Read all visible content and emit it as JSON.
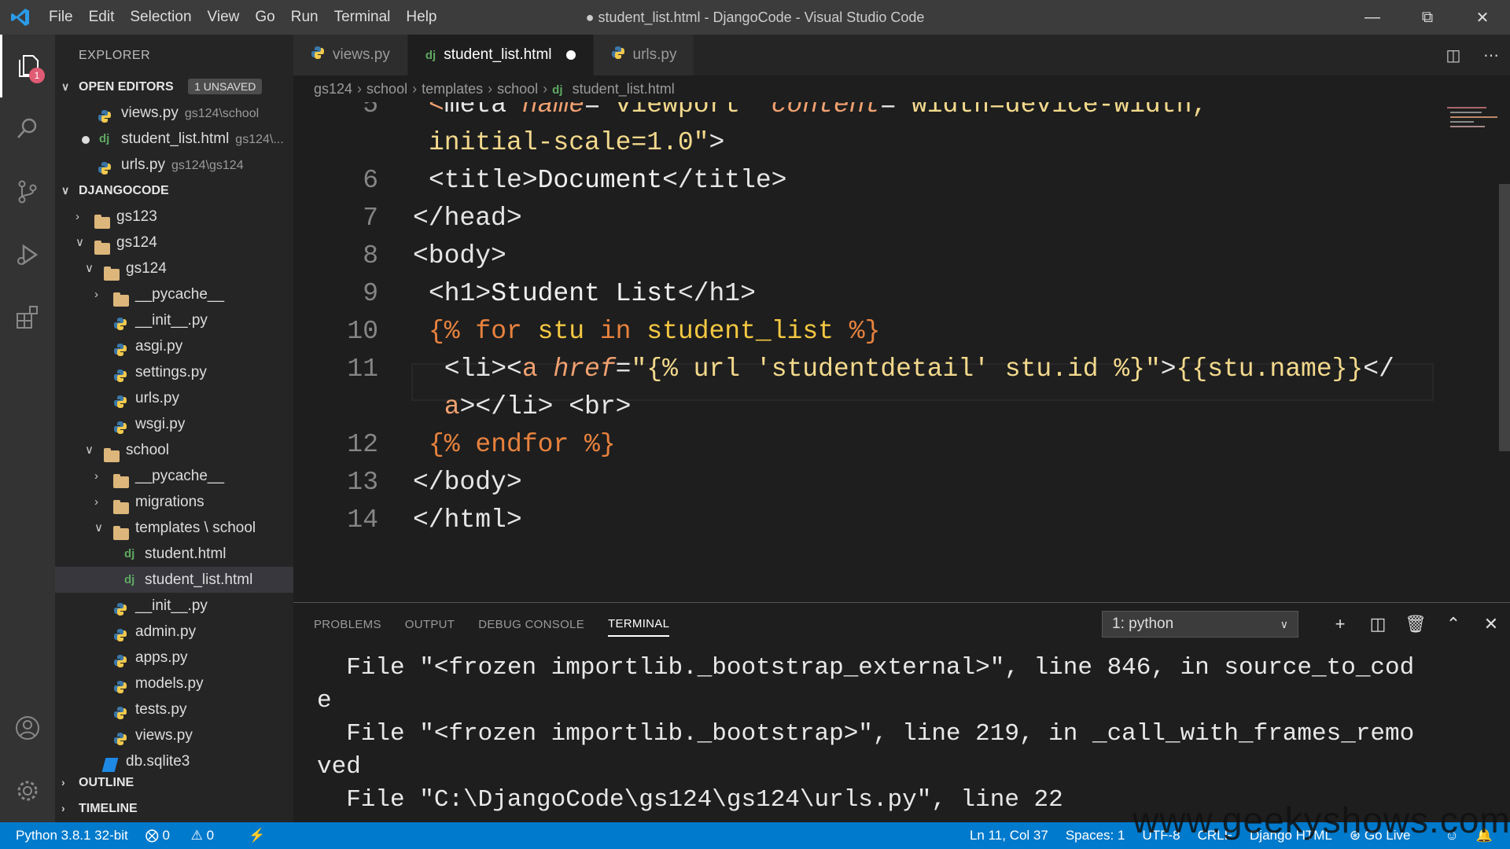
{
  "titlebar": {
    "menu": [
      "File",
      "Edit",
      "Selection",
      "View",
      "Go",
      "Run",
      "Terminal",
      "Help"
    ],
    "title": "● student_list.html - DjangoCode - Visual Studio Code"
  },
  "activity": {
    "explorer_badge": "1"
  },
  "explorer": {
    "header": "EXPLORER",
    "open_editors": {
      "label": "OPEN EDITORS",
      "unsaved": "1 UNSAVED",
      "items": [
        {
          "name": "views.py",
          "desc": "gs124\\school"
        },
        {
          "name": "student_list.html",
          "desc": "gs124\\..."
        },
        {
          "name": "urls.py",
          "desc": "gs124\\gs124"
        }
      ]
    },
    "project": {
      "label": "DJANGOCODE",
      "tree": [
        {
          "name": "gs123",
          "type": "folder",
          "depth": 0,
          "open": false
        },
        {
          "name": "gs124",
          "type": "folder",
          "depth": 0,
          "open": true
        },
        {
          "name": "gs124",
          "type": "folder",
          "depth": 1,
          "open": true
        },
        {
          "name": "__pycache__",
          "type": "folder",
          "depth": 2,
          "open": false
        },
        {
          "name": "__init__.py",
          "type": "py",
          "depth": 2
        },
        {
          "name": "asgi.py",
          "type": "py",
          "depth": 2
        },
        {
          "name": "settings.py",
          "type": "py",
          "depth": 2
        },
        {
          "name": "urls.py",
          "type": "py",
          "depth": 2
        },
        {
          "name": "wsgi.py",
          "type": "py",
          "depth": 2
        },
        {
          "name": "school",
          "type": "folder",
          "depth": 1,
          "open": true
        },
        {
          "name": "__pycache__",
          "type": "folder",
          "depth": 2,
          "open": false
        },
        {
          "name": "migrations",
          "type": "folder",
          "depth": 2,
          "open": false
        },
        {
          "name": "templates \\ school",
          "type": "folder",
          "depth": 2,
          "open": true
        },
        {
          "name": "student.html",
          "type": "dj",
          "depth": 3
        },
        {
          "name": "student_list.html",
          "type": "dj",
          "depth": 3,
          "selected": true
        },
        {
          "name": "__init__.py",
          "type": "py",
          "depth": 2
        },
        {
          "name": "admin.py",
          "type": "py",
          "depth": 2
        },
        {
          "name": "apps.py",
          "type": "py",
          "depth": 2
        },
        {
          "name": "models.py",
          "type": "py",
          "depth": 2
        },
        {
          "name": "tests.py",
          "type": "py",
          "depth": 2
        },
        {
          "name": "views.py",
          "type": "py",
          "depth": 2
        },
        {
          "name": "db.sqlite3",
          "type": "db",
          "depth": 1
        }
      ]
    },
    "outline": "OUTLINE",
    "timeline": "TIMELINE"
  },
  "tabs": [
    {
      "label": "views.py",
      "icon": "python-icon"
    },
    {
      "label": "student_list.html",
      "icon": "django-icon",
      "active": true,
      "modified": true
    },
    {
      "label": "urls.py",
      "icon": "python-icon"
    }
  ],
  "breadcrumb": {
    "parts": [
      "gs124",
      "school",
      "templates",
      "school"
    ],
    "file": "student_list.html"
  },
  "code": {
    "lines": [
      {
        "n": "5",
        "tokens": [
          [
            "t-br",
            "<"
          ],
          [
            "t-tag",
            "meta "
          ],
          [
            "t-at",
            "name"
          ],
          [
            "t-tag",
            "="
          ],
          [
            "t-str",
            "\"viewport\" "
          ],
          [
            "t-at",
            "content"
          ],
          [
            "t-tag",
            "="
          ],
          [
            "t-str",
            "\"width=device-width,"
          ]
        ]
      },
      {
        "n": "",
        "tokens": [
          [
            "t-str",
            "initial-scale=1.0\""
          ],
          [
            "t-tag",
            ">"
          ]
        ]
      },
      {
        "n": "6",
        "tokens": [
          [
            "t-tag",
            "<title>"
          ],
          [
            "t-txt",
            "Document"
          ],
          [
            "t-tag",
            "</title>"
          ]
        ]
      },
      {
        "n": "7",
        "tokens": [
          [
            "t-tag",
            "</head>"
          ]
        ]
      },
      {
        "n": "8",
        "tokens": [
          [
            "t-tag",
            "<body>"
          ]
        ]
      },
      {
        "n": "9",
        "tokens": [
          [
            "t-tag",
            "<h1>"
          ],
          [
            "t-txt",
            "Student List"
          ],
          [
            "t-tag",
            "</h1>"
          ]
        ]
      },
      {
        "n": "10",
        "tokens": [
          [
            "t-tp",
            "{% "
          ],
          [
            "t-kw",
            "for "
          ],
          [
            "t-id",
            "stu "
          ],
          [
            "t-kw",
            "in "
          ],
          [
            "t-id",
            "student_list "
          ],
          [
            "t-tp",
            "%}"
          ]
        ]
      },
      {
        "n": "11",
        "tokens": [
          [
            "t-tag",
            " <li><"
          ],
          [
            "t-br",
            "a "
          ],
          [
            "t-at",
            "href"
          ],
          [
            "t-tag",
            "="
          ],
          [
            "t-str",
            "\"{% url 'studentdetail' stu.id %}\""
          ],
          [
            "t-tag",
            ">"
          ],
          [
            "t-str",
            "{{stu.name}}"
          ],
          [
            "t-tag",
            "</"
          ]
        ]
      },
      {
        "n": "",
        "tokens": [
          [
            "t-br",
            " a"
          ],
          [
            "t-tag",
            "></li> <br>"
          ]
        ]
      },
      {
        "n": "12",
        "tokens": [
          [
            "t-tp",
            "{% "
          ],
          [
            "t-kw",
            "endfor "
          ],
          [
            "t-tp",
            "%}"
          ]
        ]
      },
      {
        "n": "13",
        "tokens": [
          [
            "t-tag",
            "</body>"
          ]
        ]
      },
      {
        "n": "14",
        "tokens": [
          [
            "t-tag",
            "</html>"
          ]
        ]
      }
    ]
  },
  "panel": {
    "tabs": [
      "PROBLEMS",
      "OUTPUT",
      "DEBUG CONSOLE",
      "TERMINAL"
    ],
    "active": "TERMINAL",
    "terminal_select": "1: python",
    "terminal_lines": [
      "  File \"<frozen importlib._bootstrap_external>\", line 846, in source_to_cod",
      "e",
      "  File \"<frozen importlib._bootstrap>\", line 219, in _call_with_frames_remo",
      "ved",
      "  File \"C:\\DjangoCode\\gs124\\gs124\\urls.py\", line 22"
    ]
  },
  "status": {
    "interpreter": "Python 3.8.1 32-bit",
    "errors": "0",
    "warnings": "0",
    "position": "Ln 11, Col 37",
    "spaces": "Spaces: 1",
    "encoding": "UTF-8",
    "eol": "CRLF",
    "language": "Django HTML",
    "golive": "Go Live"
  },
  "watermark": "www.geekyshows.com"
}
